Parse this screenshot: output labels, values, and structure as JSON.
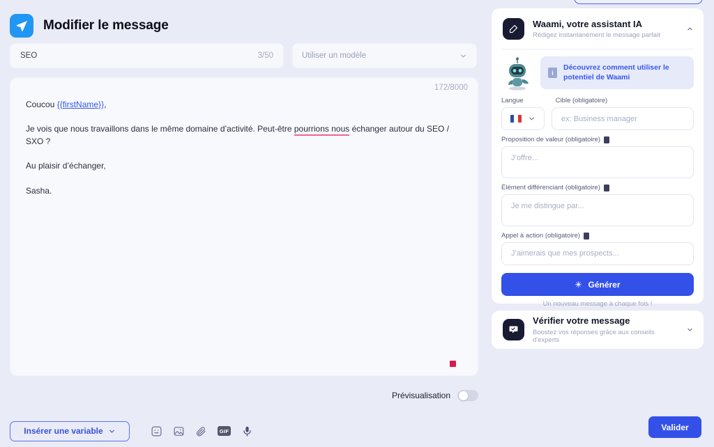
{
  "header": {
    "title": "Modifier le message",
    "icon": "send-paper-plane-icon"
  },
  "subject": {
    "value": "SEO",
    "counter": "3/50"
  },
  "template": {
    "placeholder": "Utiliser un modèle"
  },
  "message": {
    "counter": "172/8000",
    "line1_prefix": "Coucou ",
    "line1_variable": "{{firstName}}",
    "line1_suffix": ",",
    "line2_a": "Je vois que nous travaillons dans le même domaine d’activité. Peut-être ",
    "line2_grammar": "pourrions nous",
    "line2_b": " échanger autour du SEO / SXO ?",
    "line3": "Au plaisir d’échanger,",
    "line4": "Sasha."
  },
  "preview": {
    "label": "Prévisualisation",
    "enabled": false
  },
  "toolbar": {
    "insert_variable_label": "Insérer une variable",
    "icons": [
      {
        "name": "emoji-icon",
        "label": "Emoji"
      },
      {
        "name": "image-icon",
        "label": "Image"
      },
      {
        "name": "attachment-icon",
        "label": "Pièce jointe"
      },
      {
        "name": "gif-icon",
        "label": "GIF"
      },
      {
        "name": "microphone-icon",
        "label": "Audio"
      }
    ]
  },
  "validate": {
    "label": "Valider"
  },
  "waami": {
    "title": "Waami, votre assistant IA",
    "subtitle": "Rédigez instantanément le message parfait",
    "icon": "pencil-square-icon",
    "collapse_icon": "chevron-up-icon",
    "promo": "Découvrez comment utiliser le potentiel de Waami",
    "promo_icon": "info-icon",
    "mascot_icon": "robot-mascot-icon",
    "fields": {
      "language_label": "Langue",
      "language_value": "fr",
      "target_label": "Cible (obligatoire)",
      "target_placeholder": "ex: Business manager",
      "value_prop_label": "Proposition de valeur (obligatoire)",
      "value_prop_placeholder": "J’offre...",
      "differentiator_label": "Élément différenciant (obligatoire)",
      "differentiator_placeholder": "Je me distingue par...",
      "cta_label": "Appel à action (obligatoire)",
      "cta_placeholder": "J’aimerais que mes prospects..."
    },
    "generate_label": "Générer",
    "generate_icon": "sparkle-icon",
    "generate_note": "Un nouveau message à chaque fois !"
  },
  "verify": {
    "title": "Vérifier votre message",
    "subtitle": "Boostez vos réponses grâce aux conseils d'experts",
    "icon": "speech-bubble-check-icon",
    "expand_icon": "chevron-down-icon"
  },
  "colors": {
    "page_bg": "#e9ebf7",
    "accent_blue": "#3350e8",
    "header_icon_blue": "#2196f3",
    "dark_navy": "#191b33",
    "grammar_underline": "#f06292",
    "cursor_mark": "#d81b4a"
  }
}
